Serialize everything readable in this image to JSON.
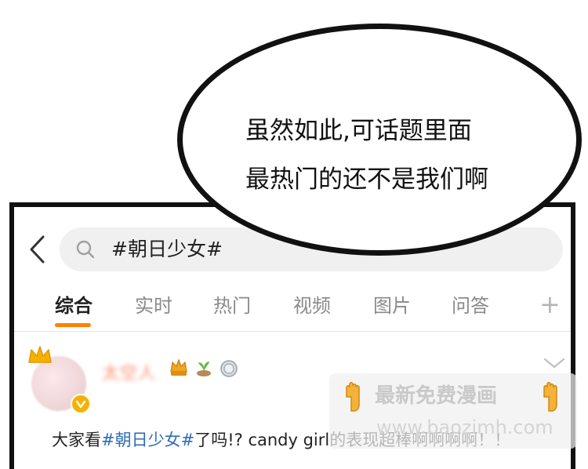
{
  "speech_bubble": {
    "line1": "虽然如此,可话题里面",
    "line2": "最热门的还不是我们啊"
  },
  "search": {
    "query": "#朝日少女#"
  },
  "tabs": [
    {
      "label": "综合",
      "active": true
    },
    {
      "label": "实时",
      "active": false
    },
    {
      "label": "热门",
      "active": false
    },
    {
      "label": "视频",
      "active": false
    },
    {
      "label": "图片",
      "active": false
    },
    {
      "label": "问答",
      "active": false
    }
  ],
  "tab_add_label": "+",
  "post": {
    "username": "太空人",
    "text_before": "大家看",
    "tag": "#朝日少女#",
    "text_after": "了吗!? candy girl的表现超棒啊啊啊啊！！"
  },
  "watermark": {
    "title": "最新免费漫画",
    "url": "www.baozimh.com"
  },
  "colors": {
    "accent": "#ff8200",
    "tag_blue": "#2f6db5",
    "verified": "#f6b100"
  },
  "icons": [
    "back-icon",
    "search-icon",
    "plus-icon",
    "crown-icon",
    "verified-icon",
    "chevron-down-icon",
    "pointing-hand-icon"
  ]
}
